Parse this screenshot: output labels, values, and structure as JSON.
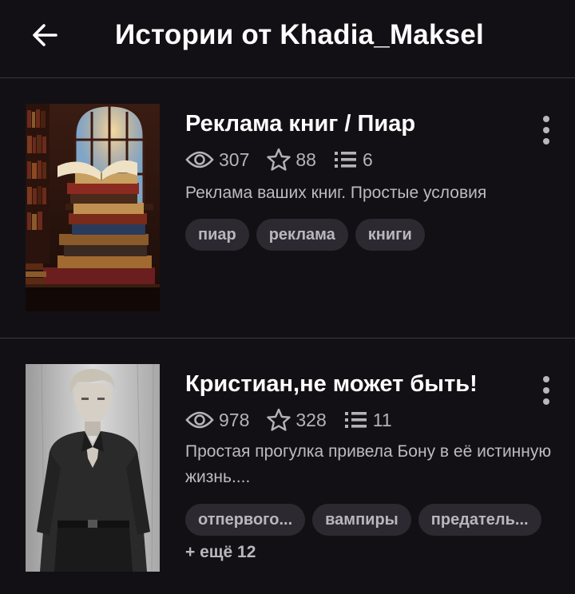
{
  "header": {
    "title": "Истории от Khadia_Maksel",
    "back_icon": "arrow-left-icon"
  },
  "stories": [
    {
      "title": "Реклама книг / Пиар",
      "views": "307",
      "votes": "88",
      "parts": "6",
      "description": "Реклама ваших книг. Простые условия",
      "tags": [
        "пиар",
        "реклама",
        "книги"
      ],
      "more_tags": ""
    },
    {
      "title": "Кристиан,не может быть!",
      "views": "978",
      "votes": "328",
      "parts": "11",
      "description": "Простая прогулка привела Бону в её истинную жизнь....",
      "tags": [
        "отпервого...",
        "вампиры",
        "предатель..."
      ],
      "more_tags": "+ ещё 12"
    }
  ],
  "icons": {
    "views": "eye-icon",
    "votes": "star-icon",
    "parts": "list-icon",
    "menu": "more-vertical-icon"
  },
  "colors": {
    "background": "#121014",
    "divider": "#3a383d",
    "tag_background": "#2c2a30",
    "muted_text": "#b5b3b8"
  }
}
